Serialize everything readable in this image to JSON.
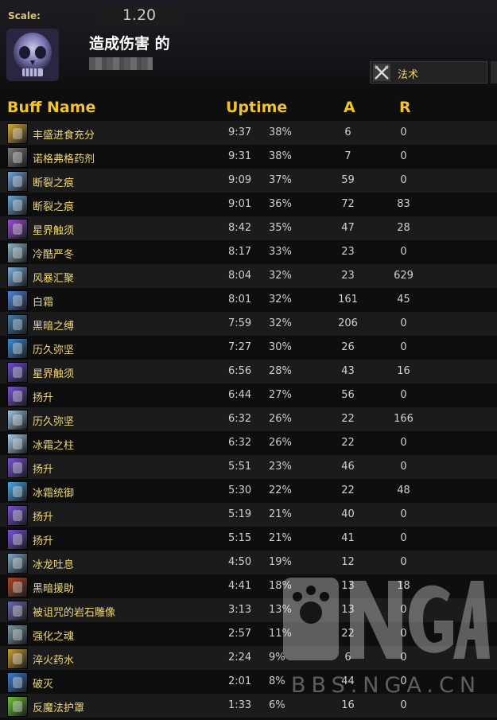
{
  "header": {
    "scale_label": "Scale:",
    "scale_value": "1.20",
    "title": "造成伤害 的",
    "tab_label": "法术",
    "tab_icon": "crossed-swords-icon"
  },
  "columns": {
    "name": "Buff Name",
    "uptime": "Uptime",
    "a": "A",
    "r": "R"
  },
  "buffs": [
    {
      "name": "丰盛进食充分",
      "time": "9:37",
      "pct": "38%",
      "a": "6",
      "r": "0",
      "icon": "food-icon",
      "color": "#d9a93a"
    },
    {
      "name": "诺格弗格药剂",
      "time": "9:31",
      "pct": "38%",
      "a": "7",
      "r": "0",
      "icon": "potion-icon",
      "color": "#7b7b7b"
    },
    {
      "name": "断裂之痕",
      "time": "9:09",
      "pct": "37%",
      "a": "59",
      "r": "0",
      "icon": "frost-shard-icon",
      "color": "#6fa6d8"
    },
    {
      "name": "断裂之痕",
      "time": "9:01",
      "pct": "36%",
      "a": "72",
      "r": "83",
      "icon": "frost-shard-icon",
      "color": "#6fa6d8"
    },
    {
      "name": "星界触须",
      "time": "8:42",
      "pct": "35%",
      "a": "47",
      "r": "28",
      "icon": "tentacle-icon",
      "color": "#9a4fd6"
    },
    {
      "name": "冷酷严冬",
      "time": "8:17",
      "pct": "33%",
      "a": "23",
      "r": "0",
      "icon": "winter-icon",
      "color": "#8fb6c8"
    },
    {
      "name": "风暴汇聚",
      "time": "8:04",
      "pct": "32%",
      "a": "23",
      "r": "629",
      "icon": "storm-icon",
      "color": "#7ab0e0"
    },
    {
      "name": "白霜",
      "time": "8:01",
      "pct": "32%",
      "a": "161",
      "r": "45",
      "icon": "rime-icon",
      "color": "#4f86e0"
    },
    {
      "name": "黑暗之缚",
      "time": "7:59",
      "pct": "32%",
      "a": "206",
      "r": "0",
      "icon": "dark-bind-icon",
      "color": "#3f7fb0"
    },
    {
      "name": "历久弥坚",
      "time": "7:27",
      "pct": "30%",
      "a": "26",
      "r": "0",
      "icon": "vortex-icon",
      "color": "#3a8fd8"
    },
    {
      "name": "星界触须",
      "time": "6:56",
      "pct": "28%",
      "a": "43",
      "r": "16",
      "icon": "astral-icon",
      "color": "#6a4ed0"
    },
    {
      "name": "扬升",
      "time": "6:44",
      "pct": "27%",
      "a": "56",
      "r": "0",
      "icon": "ascend-icon",
      "color": "#7a52d8"
    },
    {
      "name": "历久弥坚",
      "time": "6:32",
      "pct": "26%",
      "a": "22",
      "r": "166",
      "icon": "ice-blade-icon",
      "color": "#9ec6e6"
    },
    {
      "name": "冰霜之柱",
      "time": "6:32",
      "pct": "26%",
      "a": "22",
      "r": "0",
      "icon": "ice-pillar-icon",
      "color": "#a8d0ee"
    },
    {
      "name": "扬升",
      "time": "5:51",
      "pct": "23%",
      "a": "46",
      "r": "0",
      "icon": "ascend-icon",
      "color": "#7a52d8"
    },
    {
      "name": "冰霜统御",
      "time": "5:30",
      "pct": "22%",
      "a": "22",
      "r": "48",
      "icon": "frost-dominion-icon",
      "color": "#4aa8e8"
    },
    {
      "name": "扬升",
      "time": "5:19",
      "pct": "21%",
      "a": "40",
      "r": "0",
      "icon": "ascend-icon",
      "color": "#7a52d8"
    },
    {
      "name": "扬升",
      "time": "5:15",
      "pct": "21%",
      "a": "41",
      "r": "0",
      "icon": "ascend-icon",
      "color": "#7a52d8"
    },
    {
      "name": "冰龙吐息",
      "time": "4:50",
      "pct": "19%",
      "a": "12",
      "r": "0",
      "icon": "frost-breath-icon",
      "color": "#7fa8c6"
    },
    {
      "name": "黑暗援助",
      "time": "4:41",
      "pct": "18%",
      "a": "13",
      "r": "18",
      "icon": "dark-succor-icon",
      "color": "#b0452a"
    },
    {
      "name": "被诅咒的岩石雕像",
      "time": "3:13",
      "pct": "13%",
      "a": "13",
      "r": "0",
      "icon": "cursed-statue-icon",
      "color": "#6a6ab0"
    },
    {
      "name": "强化之魂",
      "time": "2:57",
      "pct": "11%",
      "a": "22",
      "r": "0",
      "icon": "soul-icon",
      "color": "#7a9aa8"
    },
    {
      "name": "淬火药水",
      "time": "2:24",
      "pct": "9%",
      "a": "6",
      "r": "0",
      "icon": "tempered-potion-icon",
      "color": "#c8a030"
    },
    {
      "name": "破灭",
      "time": "2:01",
      "pct": "8%",
      "a": "44",
      "r": "0",
      "icon": "obliterate-icon",
      "color": "#3a7fd0"
    },
    {
      "name": "反魔法护罩",
      "time": "1:33",
      "pct": "6%",
      "a": "16",
      "r": "0",
      "icon": "anti-magic-shell-icon",
      "color": "#6fc43a"
    }
  ],
  "watermark": {
    "text": "BBS.NGA.CN",
    "logo_text": "NGA"
  }
}
